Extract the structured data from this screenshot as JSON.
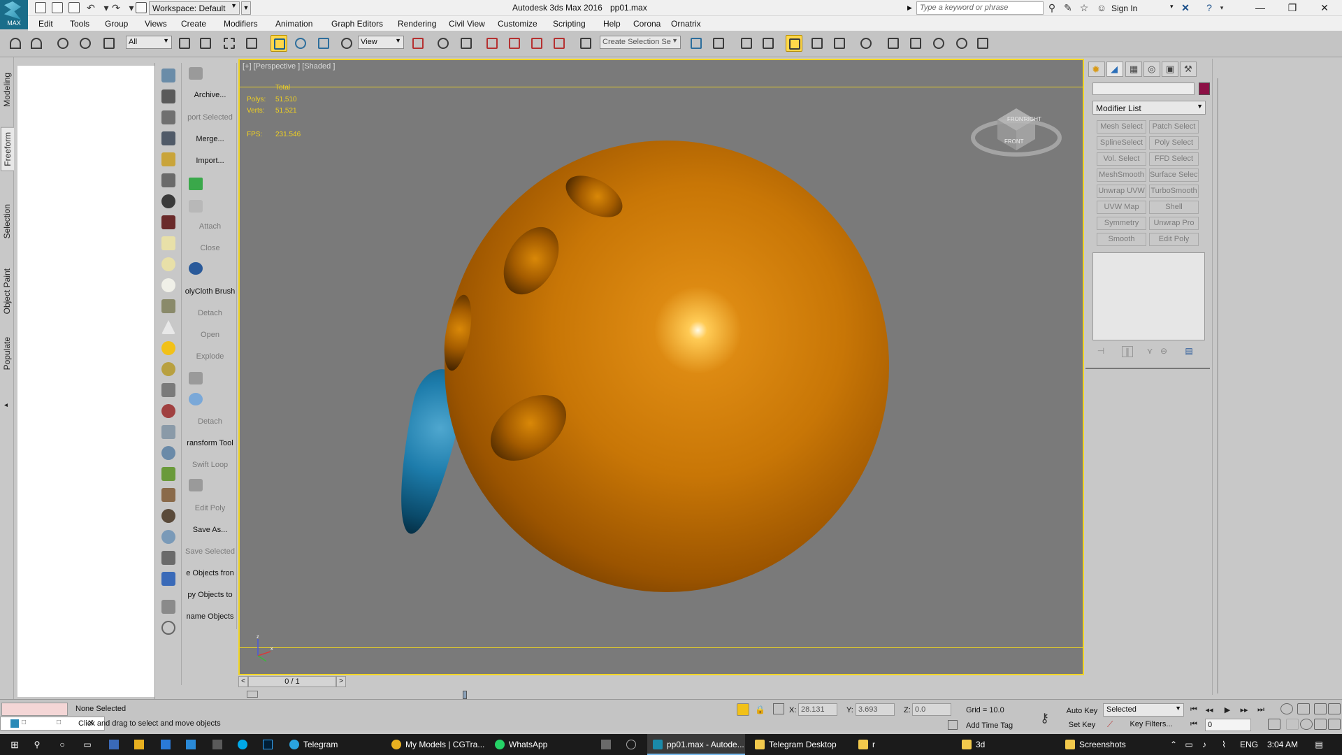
{
  "titlebar": {
    "logo_text": "MAX",
    "workspace": "Workspace: Default",
    "app_title": "Autodesk 3ds Max 2016",
    "file_title": "pp01.max",
    "search_placeholder": "Type a keyword or phrase",
    "signin": "Sign In"
  },
  "menu": [
    "Edit",
    "Tools",
    "Group",
    "Views",
    "Create",
    "Modifiers",
    "Animation",
    "Graph Editors",
    "Rendering",
    "Civil View",
    "Customize",
    "Scripting",
    "Help",
    "Corona",
    "Ornatrix"
  ],
  "toolbar": {
    "filter": "All",
    "ref_coord": "View",
    "selection_set": "Create Selection Se"
  },
  "ribbon_tabs": [
    "Modeling",
    "Freeform",
    "Selection",
    "Object Paint",
    "Populate"
  ],
  "script_panel": [
    {
      "label": "Archive...",
      "enabled": true
    },
    {
      "label": "port Selected",
      "enabled": false
    },
    {
      "label": "Merge...",
      "enabled": true
    },
    {
      "label": "Import...",
      "enabled": true
    },
    {
      "label": "Attach",
      "enabled": false
    },
    {
      "label": "Close",
      "enabled": false
    },
    {
      "label": "olyCloth Brush",
      "enabled": true
    },
    {
      "label": "Detach",
      "enabled": false
    },
    {
      "label": "Open",
      "enabled": false
    },
    {
      "label": "Explode",
      "enabled": false
    },
    {
      "label": "Detach",
      "enabled": false
    },
    {
      "label": "ransform Tool",
      "enabled": true
    },
    {
      "label": "Swift Loop",
      "enabled": false
    },
    {
      "label": "Edit Poly",
      "enabled": false
    },
    {
      "label": "Save As...",
      "enabled": true
    },
    {
      "label": "Save Selected",
      "enabled": false
    },
    {
      "label": "e Objects fron",
      "enabled": true
    },
    {
      "label": "py Objects to",
      "enabled": true
    },
    {
      "label": "name Objects",
      "enabled": true
    }
  ],
  "viewport": {
    "label": "[+] [Perspective ] [Shaded ]",
    "stats": {
      "total_label": "Total",
      "polys_label": "Polys:",
      "polys_value": "51,510",
      "verts_label": "Verts:",
      "verts_value": "51,521",
      "fps_label": "FPS:",
      "fps_value": "231.546"
    },
    "viewcube": {
      "top": "FRONT",
      "right": "RIGHT",
      "bottom": "FRONT"
    },
    "axis": {
      "z": "z",
      "x": "x"
    }
  },
  "timeslider": {
    "frame": "0 / 1",
    "prev": "<",
    "next": ">"
  },
  "command_panel": {
    "modifier_list": "Modifier List",
    "modifiers": [
      [
        "Mesh Select",
        "Patch Select"
      ],
      [
        "SplineSelect",
        "Poly Select"
      ],
      [
        "Vol. Select",
        "FFD Select"
      ],
      [
        "MeshSmooth",
        "Surface Select"
      ],
      [
        "Unwrap UVW",
        "TurboSmooth"
      ],
      [
        "UVW Map",
        "Shell"
      ],
      [
        "Symmetry",
        "Unwrap Pro"
      ],
      [
        "Smooth",
        "Edit Poly"
      ]
    ],
    "swatch_color": "#8c1045"
  },
  "status": {
    "selection": "None Selected",
    "prompt": "Click and drag to select and move objects",
    "x_label": "X:",
    "x_value": "28.131",
    "y_label": "Y:",
    "y_value": "3.693",
    "z_label": "Z:",
    "z_value": "0.0",
    "grid": "Grid = 10.0",
    "add_time_tag": "Add Time Tag",
    "auto_key": "Auto Key",
    "set_key": "Set Key",
    "selected_mode": "Selected",
    "key_filters": "Key Filters...",
    "frame": "0"
  },
  "taskbar": {
    "items": [
      "Telegram",
      "My Models | CGTra...",
      "WhatsApp",
      "pp01.max - Autode...",
      "Telegram Desktop",
      "r",
      "3d",
      "Screenshots"
    ],
    "language": "ENG",
    "time": "3:04 AM"
  },
  "colors": {
    "sphere": "#c87606",
    "teardrop": "#1d7cab",
    "viewport_border": "#f2d624",
    "active_tool": "#ffd74a"
  }
}
